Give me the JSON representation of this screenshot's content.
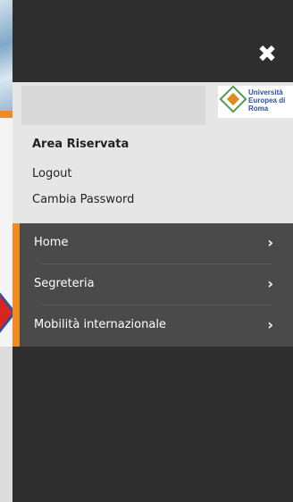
{
  "header": {
    "close_label": "✖"
  },
  "user": {
    "area_title": "Area Riservata",
    "logout_label": "Logout",
    "change_password_label": "Cambia Password"
  },
  "logo": {
    "line1": "Università",
    "line2": "Europea di",
    "line3": "Roma"
  },
  "menu": {
    "items": [
      {
        "label": "Home",
        "chevron": "›"
      },
      {
        "label": "Segreteria",
        "chevron": "›"
      },
      {
        "label": "Mobilità internazionale",
        "chevron": "›"
      }
    ]
  },
  "colors": {
    "drawer_bg": "#2e2e2e",
    "panel_bg": "#e6e6e6",
    "menu_bg": "#4a4a4a",
    "accent": "#f08a24"
  }
}
